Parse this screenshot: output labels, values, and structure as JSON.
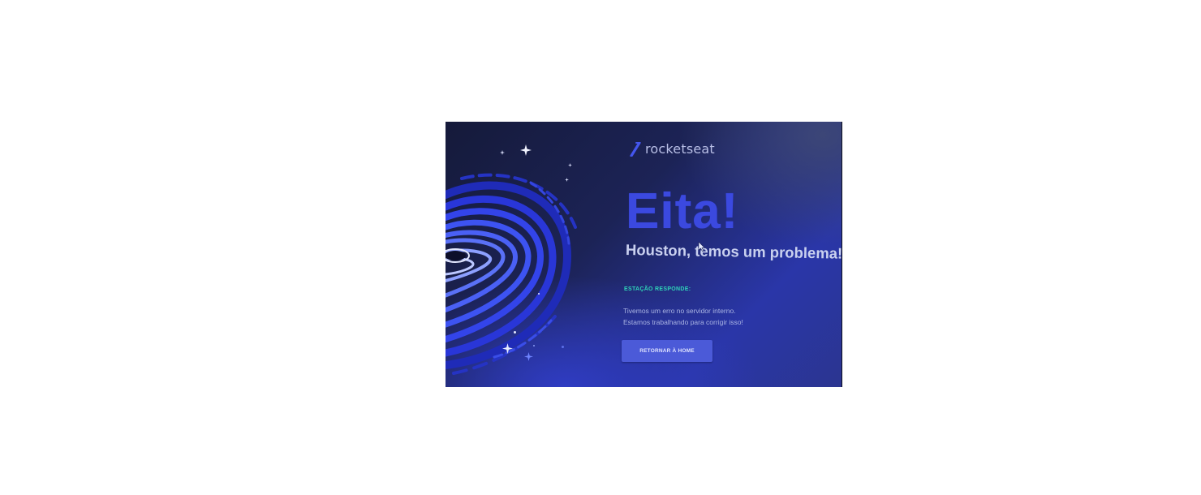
{
  "brand": {
    "name": "rocketseat",
    "logo_icon": "rocket-slash-icon"
  },
  "error": {
    "headline": "Eita!",
    "subheadline": "Houston, temos um problema!",
    "station_label": "ESTAÇÃO RESPONDE:",
    "message_line_1": "Tivemos um erro no servidor interno.",
    "message_line_2": "Estamos trabalhando para corrigir isso!"
  },
  "actions": {
    "home_button_label": "RETORNAR À HOME"
  },
  "colors": {
    "background": "#1c2356",
    "headline": "#3b49e0",
    "subheadline": "#c9d0ef",
    "accent_teal": "#2fd4b8",
    "button": "#4b5ad8"
  },
  "decor": {
    "illustration": "black-hole-swirl",
    "stars": "sparkle-star-icon"
  }
}
